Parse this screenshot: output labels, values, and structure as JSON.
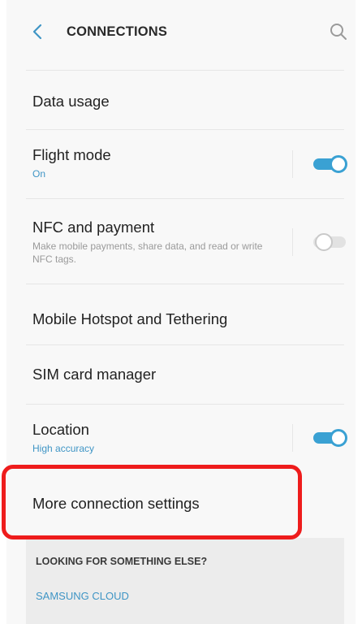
{
  "header": {
    "title": "CONNECTIONS",
    "back_icon": "chevron-left-icon",
    "search_icon": "search-icon"
  },
  "settings": [
    {
      "title": "Data usage"
    },
    {
      "title": "Flight mode",
      "subtitle": "On",
      "toggle": "on"
    },
    {
      "title": "NFC and payment",
      "subtitle": "Make mobile payments, share data, and read or write NFC tags.",
      "toggle": "off"
    },
    {
      "title": "Mobile Hotspot and Tethering"
    },
    {
      "title": "SIM card manager"
    },
    {
      "title": "Location",
      "subtitle": "High accuracy",
      "toggle": "on"
    },
    {
      "title": "More connection settings"
    }
  ],
  "footer": {
    "title": "LOOKING FOR SOMETHING ELSE?",
    "link": "SAMSUNG CLOUD"
  },
  "colors": {
    "accent": "#3aa1d3",
    "link": "#3f95c5",
    "highlight": "#ee1c1c"
  }
}
